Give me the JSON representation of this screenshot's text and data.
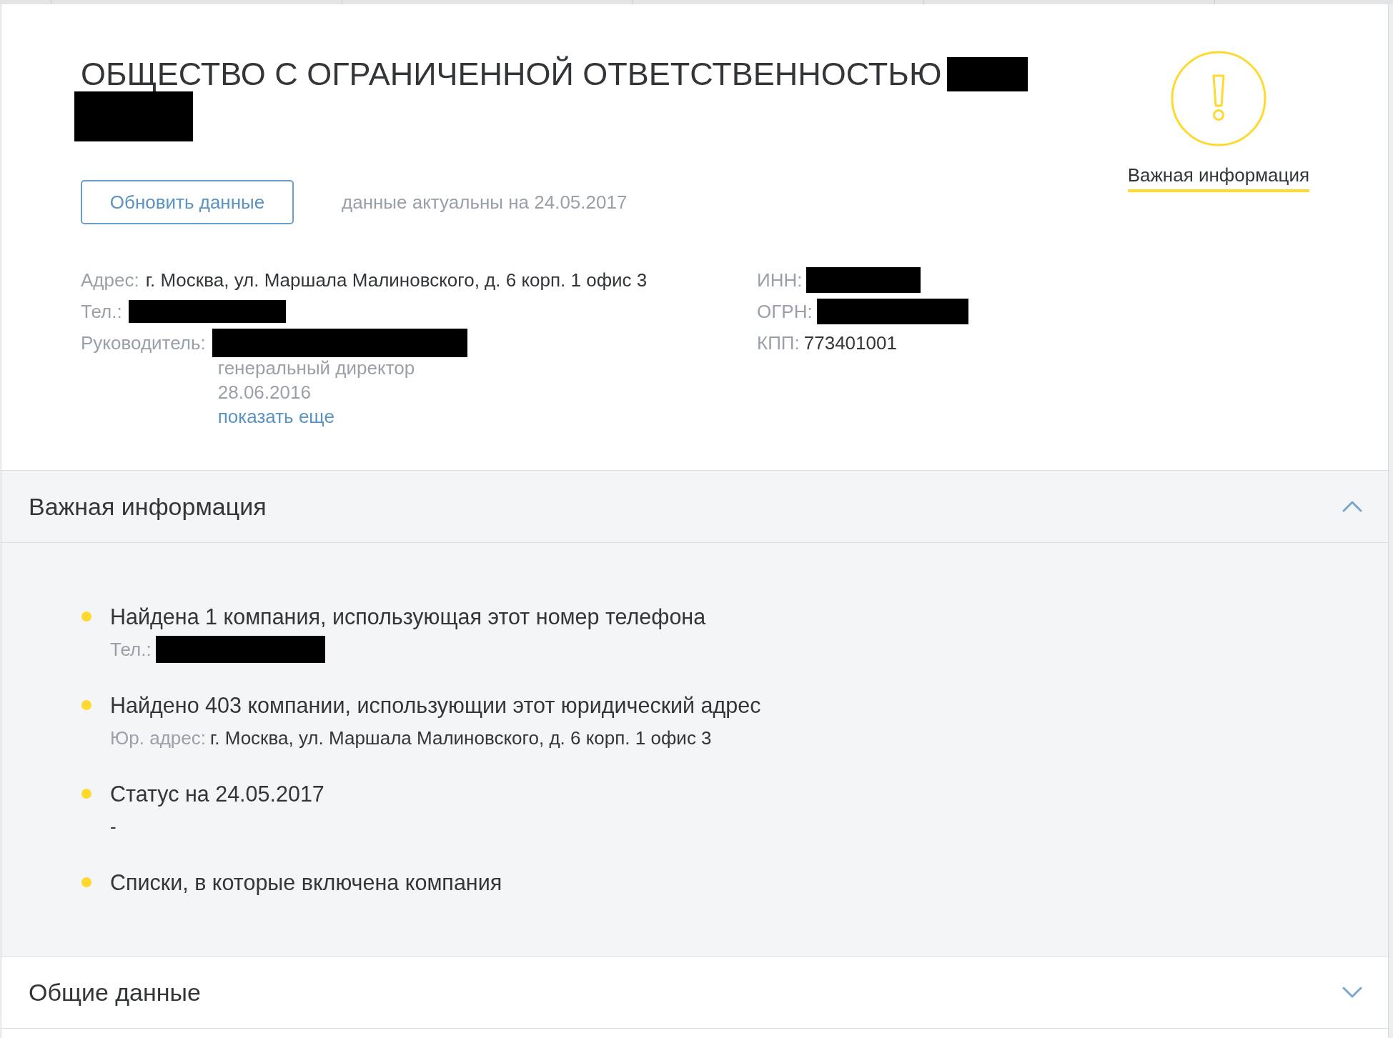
{
  "company": {
    "title": "ОБЩЕСТВО С ОГРАНИЧЕННОЙ ОТВЕТСТВЕННОСТЬЮ",
    "name_redacted": true
  },
  "important_link": {
    "label": "Важная информация"
  },
  "refresh_button": {
    "label": "Обновить данные"
  },
  "updated_note": "данные актуальны на 24.05.2017",
  "details": {
    "left": [
      {
        "label": "Адрес:",
        "value": "г. Москва, ул. Маршала Малиновского, д. 6 корп. 1 офис 3",
        "redacted": false
      },
      {
        "label": "Тел.:",
        "redacted": true
      },
      {
        "label": "Руководитель:",
        "redacted": true,
        "extra": [
          "генеральный директор",
          "28.06.2016"
        ],
        "link": "показать еще"
      }
    ],
    "right": [
      {
        "label": "ИНН:",
        "redacted": true
      },
      {
        "label": "ОГРН:",
        "redacted": true
      },
      {
        "label": "КПП:",
        "value": "773401001",
        "redacted": false
      }
    ]
  },
  "sections": [
    {
      "title": "Важная информация",
      "expanded": true,
      "items": [
        {
          "title": "Найдена 1 компания, использующая этот номер телефона",
          "detail": {
            "label": "Тел.:",
            "redacted": true
          }
        },
        {
          "title": "Найдено 403 компании, использующии этот юридический адрес",
          "detail": {
            "label": "Юр. адрес:",
            "value": "г. Москва, ул. Маршала Малиновского, д. 6 корп. 1 офис 3",
            "redacted": false
          }
        },
        {
          "title": "Статус на 24.05.2017",
          "detail": {
            "value": "-",
            "redacted": false
          }
        },
        {
          "title": "Списки, в которые включена компания"
        }
      ]
    },
    {
      "title": "Общие данные",
      "expanded": false
    }
  ]
}
